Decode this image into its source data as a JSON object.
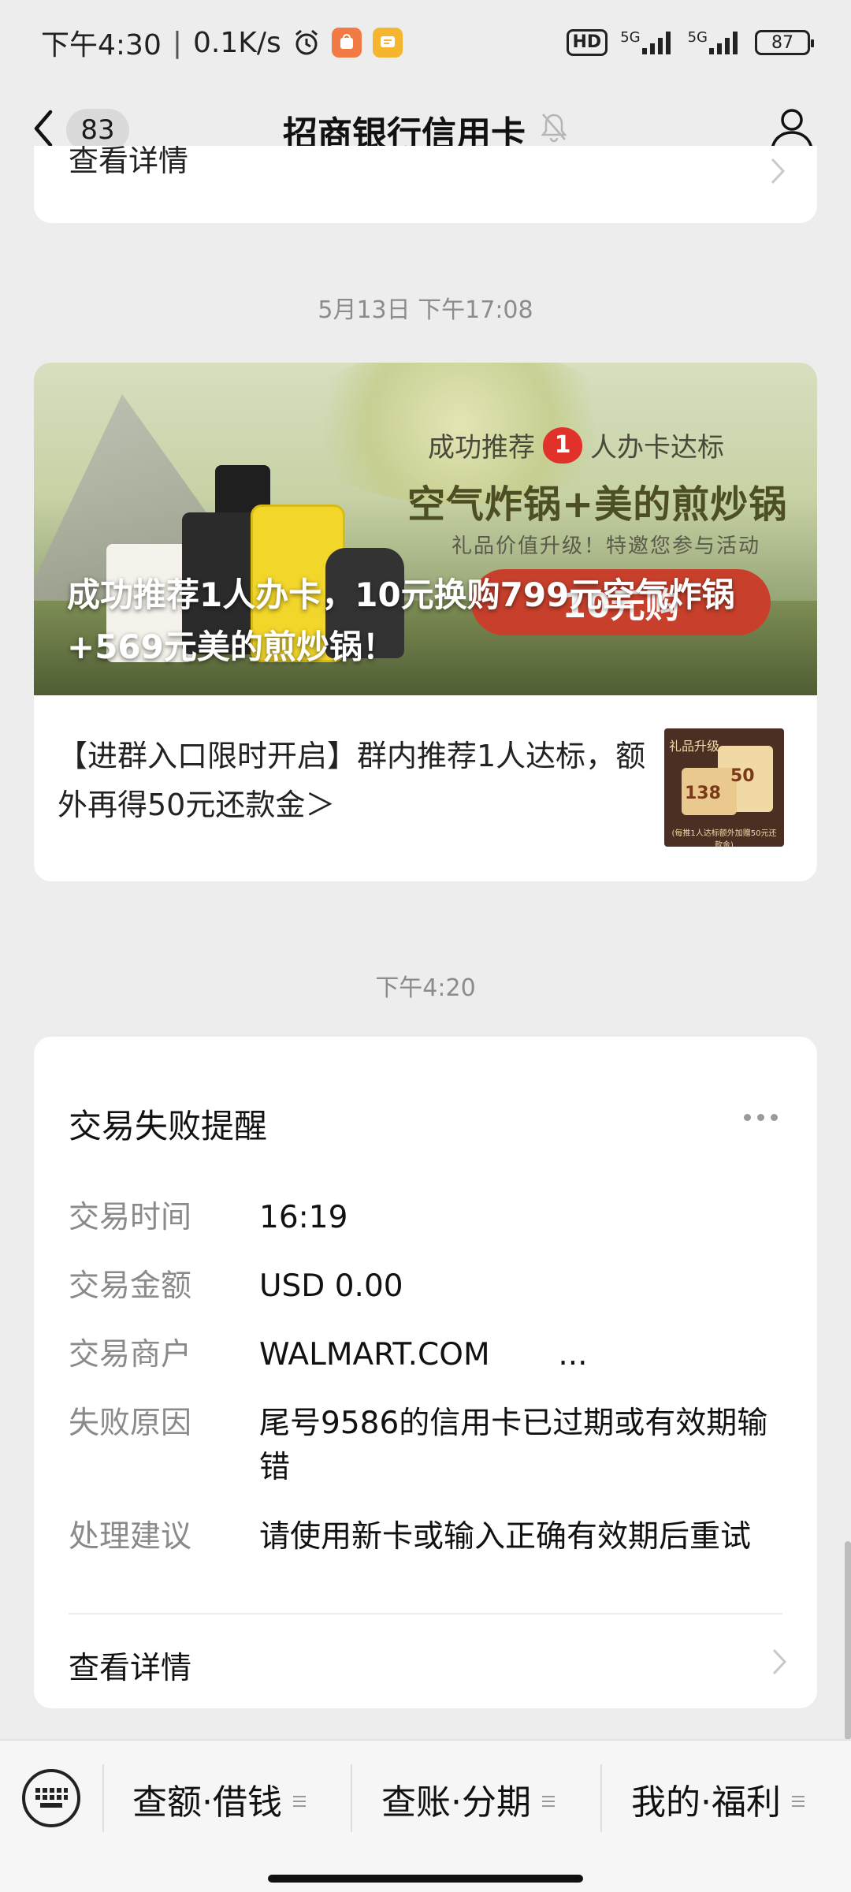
{
  "status_bar": {
    "time": "下午4:30",
    "network_speed": "0.1K/s",
    "hd_label": "HD",
    "sim1_label": "5G",
    "sim2_label": "5G",
    "battery": "87"
  },
  "nav": {
    "back_count": "83",
    "title": "招商银行信用卡"
  },
  "prev_card": {
    "label": "查看详情"
  },
  "timestamps": {
    "first": "5月13日 下午17:08",
    "second": "下午4:20"
  },
  "promo": {
    "banner_headline_prefix": "成功推荐",
    "banner_headline_num": "1",
    "banner_headline_suffix": "人办卡达标",
    "banner_big": "空气炸锅+美的煎炒锅",
    "banner_sub": "礼品价值升级！特邀您参与活动",
    "banner_button": "10元购",
    "caption": "成功推荐1人办卡，10元换购799元空气炸锅+569元美的煎炒锅！",
    "text": "【进群入口限时开启】群内推荐1人达标，额外再得50元还款金＞",
    "thumb_tag": "礼品升级",
    "thumb_value1": "138",
    "thumb_value2": "50",
    "thumb_note": "(每推1人达标额外加赠50元还款金)"
  },
  "alert": {
    "title": "交易失败提醒",
    "rows": [
      {
        "key": "交易时间",
        "value": "16:19"
      },
      {
        "key": "交易金额",
        "value": "USD 0.00"
      },
      {
        "key": "交易商户",
        "value": "WALMART.COM       ..."
      },
      {
        "key": "失败原因",
        "value": "尾号9586的信用卡已过期或有效期输错"
      },
      {
        "key": "处理建议",
        "value": "请使用新卡或输入正确有效期后重试"
      }
    ],
    "detail_label": "查看详情"
  },
  "bottom_menu": {
    "items": [
      "查额·借钱",
      "查账·分期",
      "我的·福利"
    ]
  }
}
